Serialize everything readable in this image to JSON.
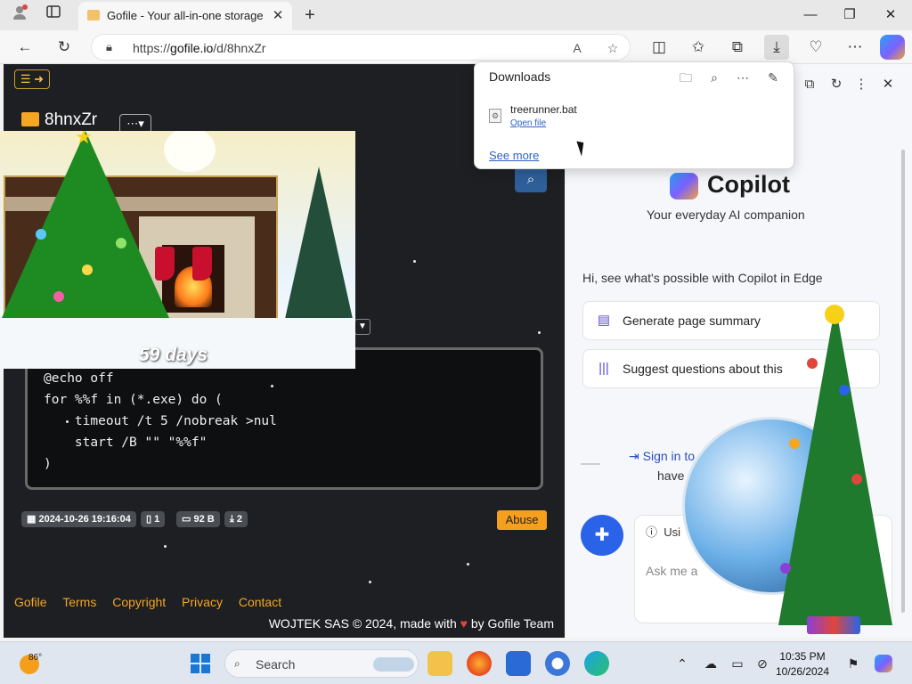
{
  "browser": {
    "tab": {
      "title": "Gofile - Your all-in-one storage so"
    },
    "address": {
      "url_prefix": "https://",
      "url_host": "gofile.io",
      "url_path": "/d/8hnxZr"
    }
  },
  "gofile": {
    "folder_name": "8hnxZr",
    "code": "@echo off\nfor %%f in (*.exe) do (\n    timeout /t 5 /nobreak >nul\n    start /B \"\" \"%%f\"\n)",
    "meta": {
      "date": "2024-10-26 19:16:04",
      "files": "1",
      "size": "92 B",
      "downloads": "2"
    },
    "abuse_label": "Abuse",
    "footer_links": [
      "Gofile",
      "Terms",
      "Copyright",
      "Privacy",
      "Contact"
    ],
    "footer_credit_prefix": "WOJTEK SAS © 2024, made with",
    "footer_credit_suffix": "by Gofile Team"
  },
  "xmas_popup": {
    "countdown": "59 days"
  },
  "downloads_panel": {
    "title": "Downloads",
    "file_name": "treerunner.bat",
    "open_file": "Open file",
    "see_more": "See more"
  },
  "copilot": {
    "title": "Copilot",
    "subtitle": "Your everyday AI companion",
    "hint": "Hi, see what's possible with Copilot in Edge",
    "cards": [
      {
        "label": "Generate page summary",
        "icon": "document-icon"
      },
      {
        "label": "Suggest questions about this",
        "icon": "library-icon"
      }
    ],
    "signin": "Sign in to",
    "signin_sub": "have",
    "mode_label": "Usi",
    "input_placeholder": "Ask me a"
  },
  "taskbar": {
    "temperature": "86°",
    "search_placeholder": "Search",
    "time": "10:35 PM",
    "date": "10/26/2024"
  },
  "colors": {
    "gofile_accent": "#f5a623",
    "abuse": "#f5a01d",
    "copilot_blue": "#2a63e8",
    "link_blue": "#2b63c7"
  }
}
